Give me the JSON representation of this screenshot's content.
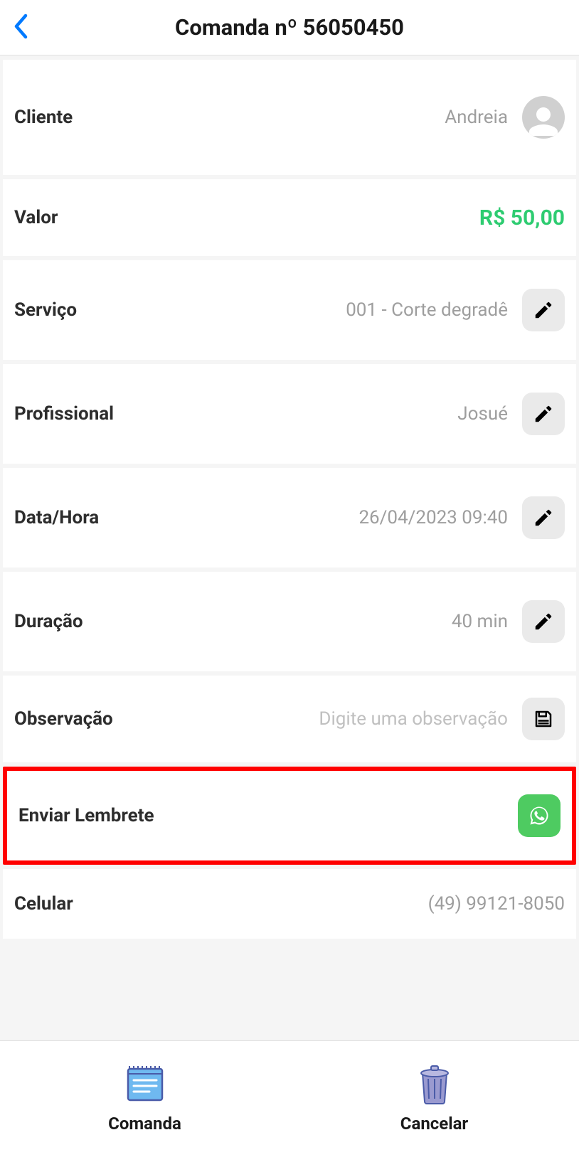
{
  "header": {
    "title": "Comanda nº 56050450"
  },
  "rows": {
    "cliente": {
      "label": "Cliente",
      "value": "Andreia"
    },
    "valor": {
      "label": "Valor",
      "value": "R$  50,00"
    },
    "servico": {
      "label": "Serviço",
      "value": "001 - Corte degradê"
    },
    "profissional": {
      "label": "Profissional",
      "value": "Josué"
    },
    "datahora": {
      "label": "Data/Hora",
      "value": "26/04/2023 09:40"
    },
    "duracao": {
      "label": "Duração",
      "value": "40 min"
    },
    "observacao": {
      "label": "Observação",
      "placeholder": "Digite uma observação"
    },
    "lembrete": {
      "label": "Enviar Lembrete"
    },
    "celular": {
      "label": "Celular",
      "value": "(49) 99121-8050"
    }
  },
  "footer": {
    "comanda": "Comanda",
    "cancelar": "Cancelar"
  }
}
